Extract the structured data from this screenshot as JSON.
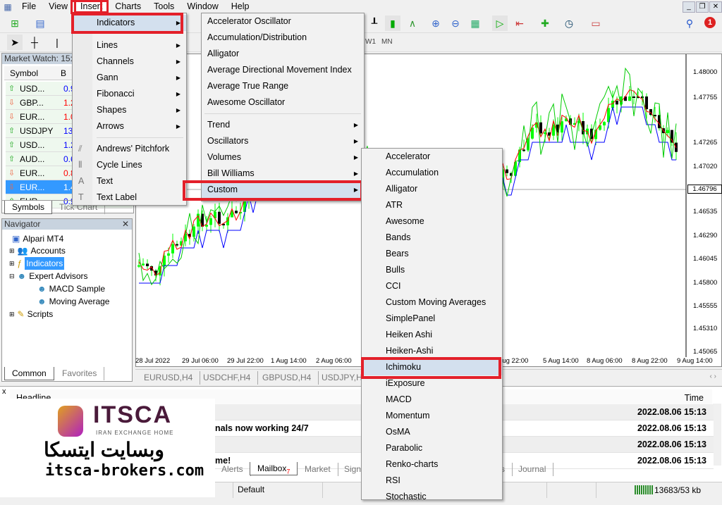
{
  "menubar": {
    "items": [
      "File",
      "View",
      "Insert",
      "Charts",
      "Tools",
      "Window",
      "Help"
    ],
    "active": "Insert"
  },
  "timeframes": [
    "W1",
    "MN"
  ],
  "market_watch": {
    "title": "Market Watch: 15:3",
    "columns": [
      "Symbol",
      "B"
    ],
    "rows": [
      {
        "symbol": "USD...",
        "bid": "0.9",
        "dir": "up",
        "color": "#0000ff"
      },
      {
        "symbol": "GBP...",
        "bid": "1.2",
        "dir": "down",
        "color": "#ff0000"
      },
      {
        "symbol": "EUR...",
        "bid": "1.0",
        "dir": "down",
        "color": "#ff0000"
      },
      {
        "symbol": "USDJPY",
        "bid": "135",
        "dir": "up",
        "color": "#0000ff"
      },
      {
        "symbol": "USD...",
        "bid": "1.2",
        "dir": "up",
        "color": "#0000ff"
      },
      {
        "symbol": "AUD...",
        "bid": "0.6",
        "dir": "up",
        "color": "#0000ff"
      },
      {
        "symbol": "EUR...",
        "bid": "0.8",
        "dir": "down",
        "color": "#ff0000"
      },
      {
        "symbol": "EUR...",
        "bid": "1.4",
        "dir": "down",
        "color": "#ffffff",
        "selected": true
      },
      {
        "symbol": "EUR...",
        "bid": "0.9",
        "dir": "up",
        "color": "#0000ff"
      }
    ],
    "tabs": [
      "Symbols",
      "Tick Chart"
    ]
  },
  "navigator": {
    "title": "Navigator",
    "root": "Alpari MT4",
    "items": [
      "Accounts",
      "Indicators",
      "Expert Advisors",
      "MACD Sample",
      "Moving Average",
      "Scripts"
    ],
    "tabs": [
      "Common",
      "Favorites"
    ]
  },
  "insert_menu": {
    "items": [
      "Indicators",
      "Lines",
      "Channels",
      "Gann",
      "Fibonacci",
      "Shapes",
      "Arrows",
      "Andrews' Pitchfork",
      "Cycle Lines",
      "Text",
      "Text Label"
    ]
  },
  "indicators_menu": {
    "items": [
      "Accelerator Oscillator",
      "Accumulation/Distribution",
      "Alligator",
      "Average Directional Movement Index",
      "Average True Range",
      "Awesome Oscillator",
      "Trend",
      "Oscillators",
      "Volumes",
      "Bill Williams",
      "Custom"
    ]
  },
  "custom_menu": {
    "items": [
      "Accelerator",
      "Accumulation",
      "Alligator",
      "ATR",
      "Awesome",
      "Bands",
      "Bears",
      "Bulls",
      "CCI",
      "Custom Moving Averages",
      "SimplePanel",
      "Heiken Ashi",
      "Heiken-Ashi",
      "Ichimoku",
      "iExposure",
      "MACD",
      "Momentum",
      "OsMA",
      "Parabolic",
      "Renko-charts",
      "RSI",
      "Stochastic"
    ],
    "highlighted": "Ichimoku"
  },
  "chart": {
    "symbol": "EURUSD,H4",
    "price_ticks": [
      "1.48000",
      "1.47755",
      "1.47265",
      "1.47020",
      "1.46535",
      "1.46290",
      "1.46045",
      "1.45800",
      "1.45555",
      "1.45310",
      "1.45065"
    ],
    "current_price": "1.46796",
    "date_ticks": [
      "28 Jul 2022",
      "29 Jul 06:00",
      "29 Jul 22:00",
      "1 Aug 14:00",
      "2 Aug 06:00",
      "Aug 22:00",
      "5 Aug 14:00",
      "8 Aug 06:00",
      "8 Aug 22:00",
      "9 Aug 14:00"
    ],
    "colors": {
      "bull": "#00ff00",
      "tenkan": "#ff0000",
      "kijun": "#0000ff",
      "chikou": "#00cc00",
      "cloud": "#c08080"
    }
  },
  "chart_tabs": [
    "EURUSD,H4",
    "USDCHF,H4",
    "GBPUSD,H4",
    "USDJPY,H4"
  ],
  "terminal": {
    "close": "x",
    "columns": [
      "Headline",
      "Time"
    ],
    "rows": [
      {
        "headline": "",
        "time": "2022.08.06 15:13"
      },
      {
        "headline": "nals now working 24/7",
        "time": "2022.08.06 15:13"
      },
      {
        "headline": "",
        "time": "2022.08.06 15:13"
      },
      {
        "headline": "me!",
        "time": "2022.08.06 15:13"
      }
    ],
    "tabs": [
      "Alerts",
      "Mailbox",
      "Market",
      "Sign",
      "s",
      "Journal"
    ],
    "mailbox_count": "7"
  },
  "status": {
    "profile": "Default",
    "traffic": "13683/53 kb"
  },
  "notification_count": "1",
  "logo": {
    "brand": "ITSCA",
    "tagline": "IRAN EXCHANGE HOME",
    "persian": "وبسایت ایتسکا",
    "url": "itsca-brokers.com"
  }
}
